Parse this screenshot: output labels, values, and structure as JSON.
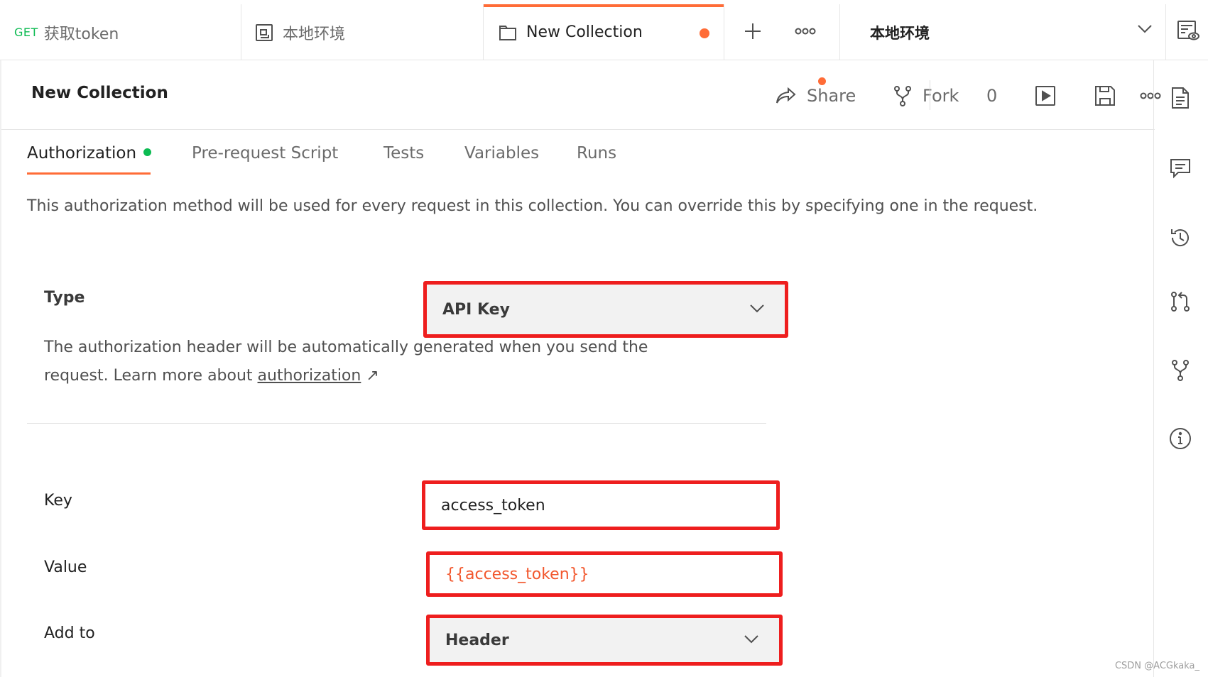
{
  "tabs": {
    "get_method": "GET",
    "get_label": "获取token",
    "env_label": "本地环境",
    "collection_label": "New Collection"
  },
  "environment": {
    "selected": "本地环境"
  },
  "header": {
    "title": "New Collection",
    "share": "Share",
    "fork": "Fork",
    "fork_count": "0"
  },
  "subtabs": [
    {
      "label": "Authorization"
    },
    {
      "label": "Pre-request Script"
    },
    {
      "label": "Tests"
    },
    {
      "label": "Variables"
    },
    {
      "label": "Runs"
    }
  ],
  "description": "This authorization method will be used for every request in this collection. You can override this by specifying one in the request.",
  "auth": {
    "type_label": "Type",
    "type_value": "API Key",
    "help_text": "The authorization header will be automatically generated when you send the request. Learn more about ",
    "help_link": "authorization",
    "help_link_arrow": "↗",
    "key_label": "Key",
    "key_value": "access_token",
    "value_label": "Value",
    "value_value": "{{access_token}}",
    "addto_label": "Add to",
    "addto_value": "Header"
  },
  "watermark": "CSDN @ACGkaka_",
  "colors": {
    "accent": "#ff6c37",
    "get_method": "#0cbb52",
    "status_dot": "#0cbb52",
    "variable": "#f2572d",
    "highlight_box": "#ee1e1e"
  }
}
